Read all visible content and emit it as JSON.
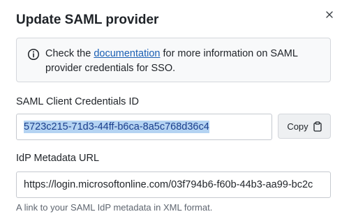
{
  "dialog": {
    "title": "Update SAML provider",
    "close_icon": "close-icon"
  },
  "info": {
    "icon": "info-icon",
    "text_before": "Check the ",
    "link_text": "documentation",
    "text_after": " for more information on SAML provider credentials for SSO."
  },
  "client_id": {
    "label": "SAML Client Credentials ID",
    "value": "5723c215-71d3-44ff-b6ca-8a5c768d36c4"
  },
  "copy_button": {
    "label": "Copy",
    "icon": "clipboard-icon"
  },
  "idp": {
    "label": "IdP Metadata URL",
    "value": "https://login.microsoftonline.com/03f794b6-f60b-44b3-aa99-bc2c",
    "help": "A link to your SAML IdP metadata in XML format."
  }
}
